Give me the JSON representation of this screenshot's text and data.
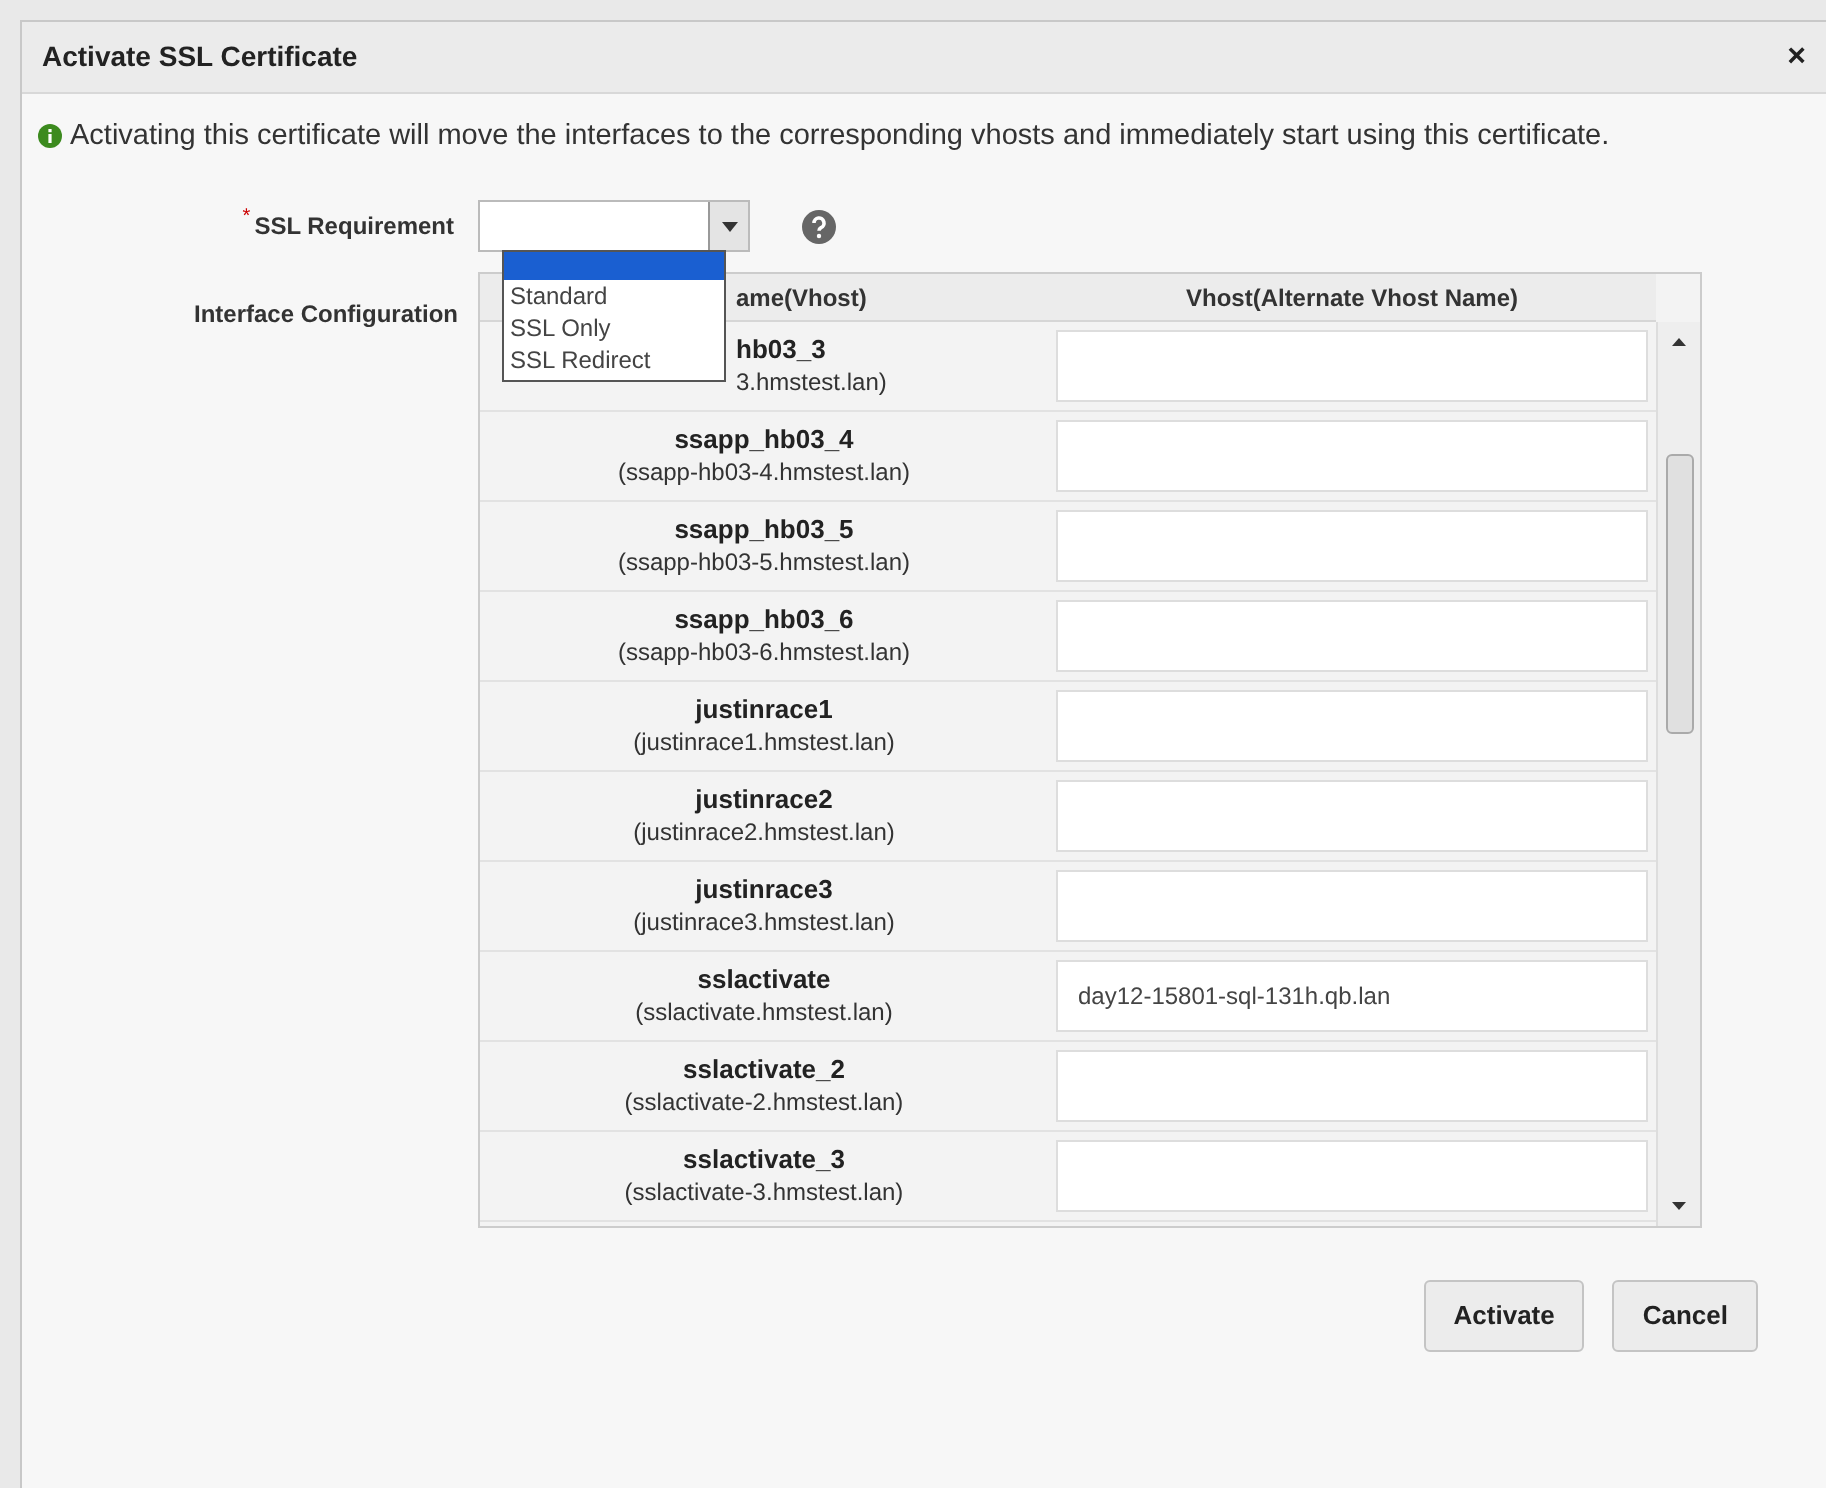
{
  "dialog": {
    "title": "Activate SSL Certificate",
    "close": "×"
  },
  "info": "Activating this certificate will move the interfaces to the corresponding vhosts and immediately start using this certificate.",
  "ssl_requirement": {
    "label": "SSL Requirement",
    "required_mark": "*",
    "dropdown": {
      "expanded": true,
      "blank_selected": true,
      "options": [
        {
          "label": "Standard",
          "selected": false
        },
        {
          "label": "SSL Only",
          "selected": false
        },
        {
          "label": "SSL Redirect",
          "selected": false
        }
      ]
    }
  },
  "interface_configuration": {
    "label": "Interface Configuration",
    "columns": [
      {
        "label": "ame(Vhost)",
        "covered": true
      },
      {
        "label": "Vhost(Alternate Vhost Name)",
        "covered": false
      }
    ],
    "rows": [
      {
        "name": "hb03_3",
        "host": "3.hmstest.lan)",
        "covered": true
      },
      {
        "name": "ssapp_hb03_4",
        "host": "(ssapp-hb03-4.hmstest.lan)",
        "covered": false
      },
      {
        "name": "ssapp_hb03_5",
        "host": "(ssapp-hb03-5.hmstest.lan)",
        "covered": false
      },
      {
        "name": "ssapp_hb03_6",
        "host": "(ssapp-hb03-6.hmstest.lan)",
        "covered": false
      },
      {
        "name": "justinrace1",
        "host": "(justinrace1.hmstest.lan)",
        "covered": false
      },
      {
        "name": "justinrace2",
        "host": "(justinrace2.hmstest.lan)",
        "covered": false
      },
      {
        "name": "justinrace3",
        "host": "(justinrace3.hmstest.lan)",
        "covered": false
      },
      {
        "name": "sslactivate",
        "host": "(sslactivate.hmstest.lan)",
        "covered": false,
        "value": "day12-15801-sql-131h.qb.lan"
      },
      {
        "name": "sslactivate_2",
        "host": "(sslactivate-2.hmstest.lan)",
        "covered": false
      },
      {
        "name": "sslactivate_3",
        "host": "(sslactivate-3.hmstest.lan)",
        "covered": false
      }
    ]
  },
  "buttons": [
    {
      "label": "Activate"
    },
    {
      "label": "Cancel"
    }
  ]
}
